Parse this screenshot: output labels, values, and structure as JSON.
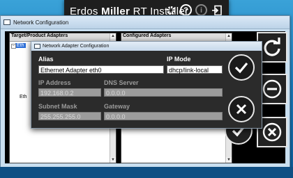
{
  "installer": {
    "title_regular": "Erdos ",
    "title_bold": "Miller",
    "title_rest": " RT Installer",
    "icons": [
      "gear-icon",
      "help-icon",
      "info-icon",
      "exit-icon"
    ],
    "help_glyph": "?",
    "info_glyph": "i"
  },
  "net_config": {
    "title": "Network Configuration",
    "left_panel_header": "Target/Product Adapters",
    "right_panel_header": "Configured Adapters",
    "left_items": [
      "Eth",
      "Eth"
    ]
  },
  "dialog": {
    "title": "Network Adapter Configuration",
    "alias_label": "Alias",
    "alias_value": "Ethernet Adapter eth0",
    "ip_mode_label": "IP Mode",
    "ip_mode_value": "dhcp/link-local",
    "ip_address_label": "IP Address",
    "ip_address_value": "192.168.0.2",
    "dns_label": "DNS Server",
    "dns_value": "0.0.0.0",
    "subnet_label": "Subnet Mask",
    "subnet_value": "255.255.255.0",
    "gateway_label": "Gateway",
    "gateway_value": "0.0.0.0"
  }
}
